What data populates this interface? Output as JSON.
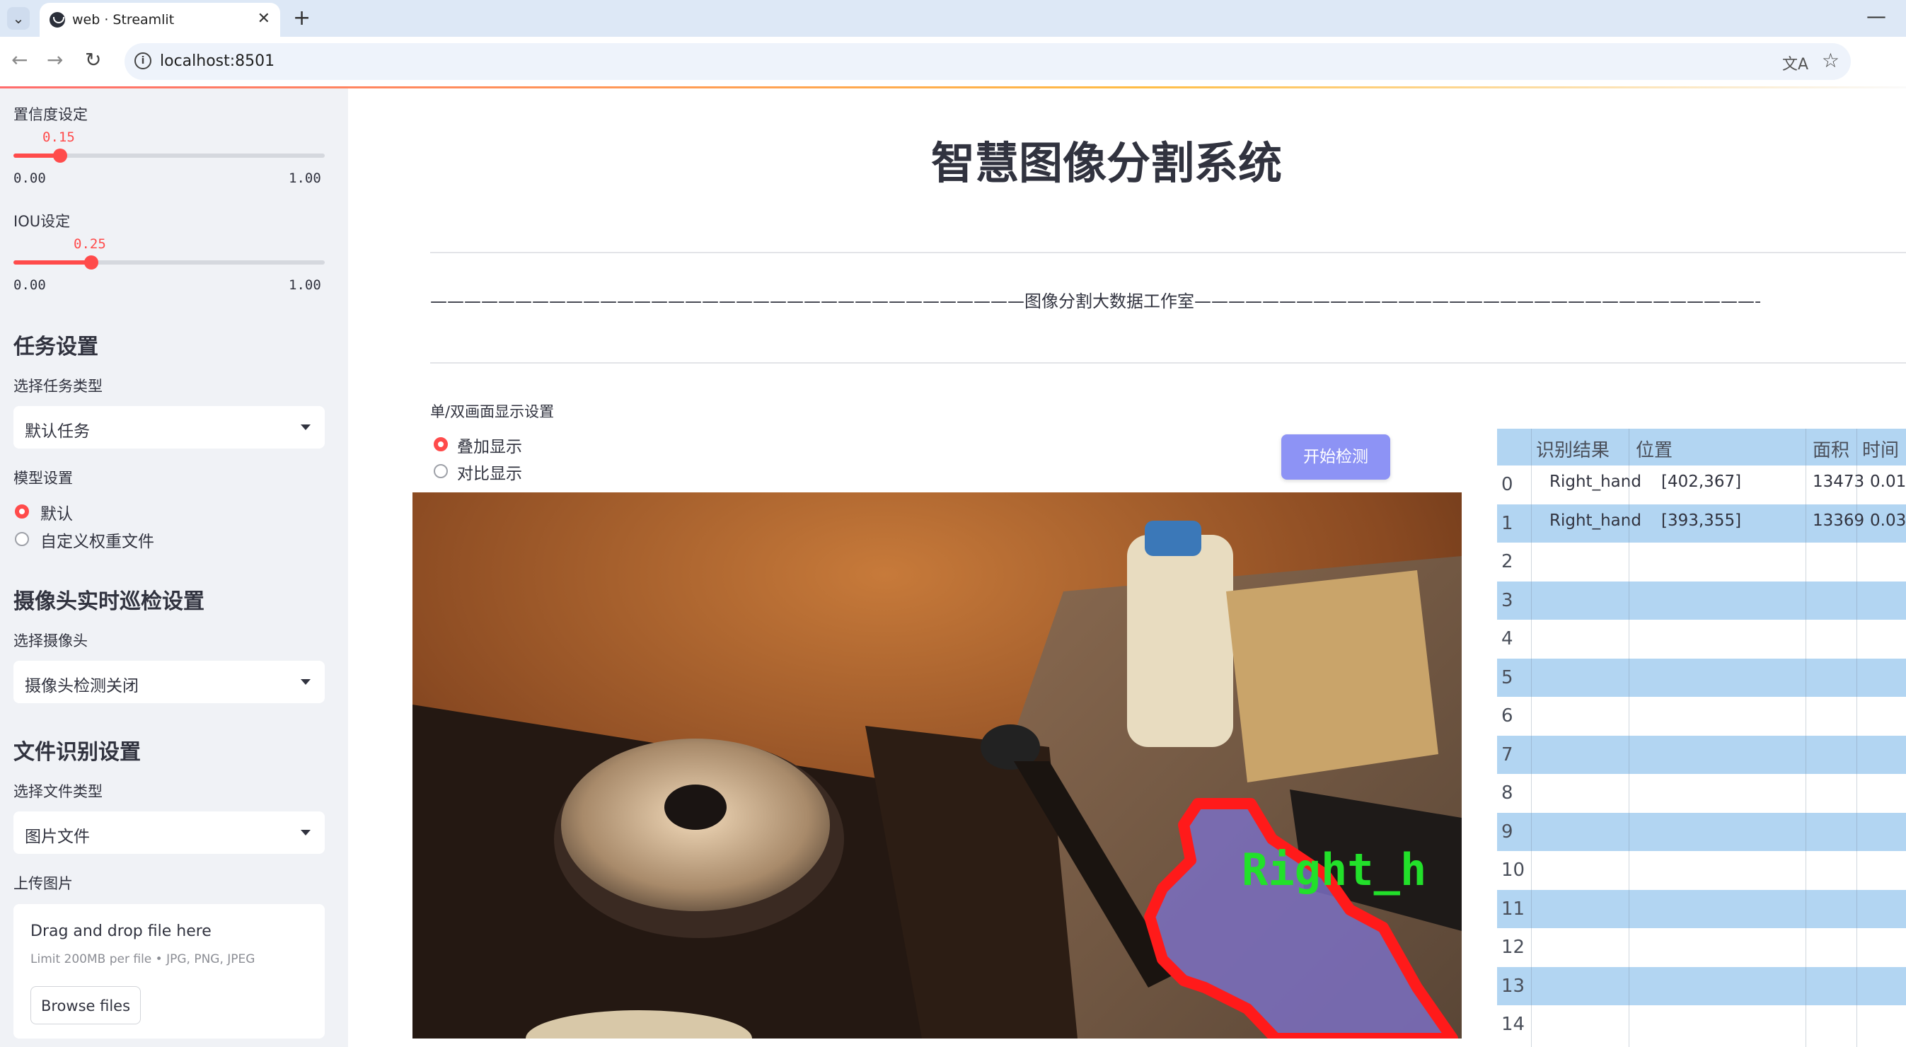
{
  "browser": {
    "tab_title": "web · Streamlit",
    "url": "localhost:8501"
  },
  "sidebar": {
    "confidence": {
      "label": "置信度设定",
      "value": "0.15",
      "value_num": 0.15,
      "min": "0.00",
      "max": "1.00"
    },
    "iou": {
      "label": "IOU设定",
      "value": "0.25",
      "value_num": 0.25,
      "min": "0.00",
      "max": "1.00"
    },
    "task_section": {
      "heading": "任务设置",
      "select_label": "选择任务类型",
      "selected": "默认任务"
    },
    "model_section": {
      "label": "模型设置",
      "options": [
        "默认",
        "自定义权重文件"
      ],
      "selected_index": 0
    },
    "camera_section": {
      "heading": "摄像头实时巡检设置",
      "select_label": "选择摄像头",
      "selected": "摄像头检测关闭"
    },
    "file_section": {
      "heading": "文件识别设置",
      "select_label": "选择文件类型",
      "selected": "图片文件"
    },
    "upload": {
      "label": "上传图片",
      "title": "Drag and drop file here",
      "subtitle": "Limit 200MB per file • JPG, PNG, JPEG",
      "button": "Browse files"
    }
  },
  "main": {
    "title": "智慧图像分割系统",
    "divider_text": "———————————————————————————————————图像分割大数据工作室———————————————————————————————————",
    "display_label": "单/双画面显示设置",
    "display_options": [
      "叠加显示",
      "对比显示"
    ],
    "display_selected_index": 0,
    "start_button": "开始检测",
    "detection_label": "Right_h"
  },
  "results_table": {
    "columns": [
      "识别结果",
      "位置",
      "面积",
      "时间"
    ],
    "rows": [
      {
        "index": "0",
        "result": "Right_hand",
        "position": "[402,367]",
        "area": "13473",
        "time": "0.01"
      },
      {
        "index": "1",
        "result": "Right_hand",
        "position": "[393,355]",
        "area": "13369",
        "time": "0.03"
      },
      {
        "index": "2"
      },
      {
        "index": "3"
      },
      {
        "index": "4"
      },
      {
        "index": "5"
      },
      {
        "index": "6"
      },
      {
        "index": "7"
      },
      {
        "index": "8"
      },
      {
        "index": "9"
      },
      {
        "index": "10"
      },
      {
        "index": "11"
      },
      {
        "index": "12"
      },
      {
        "index": "13"
      },
      {
        "index": "14"
      }
    ]
  },
  "colors": {
    "accent": "#ff4b4b",
    "button": "#8d93f5",
    "table_stripe": "#b2d5f2",
    "sidebar_bg": "#f0f2f6",
    "mask_outline": "#ff1a1a",
    "mask_fill": "#7a6fc2",
    "label_text": "#22e02a"
  }
}
